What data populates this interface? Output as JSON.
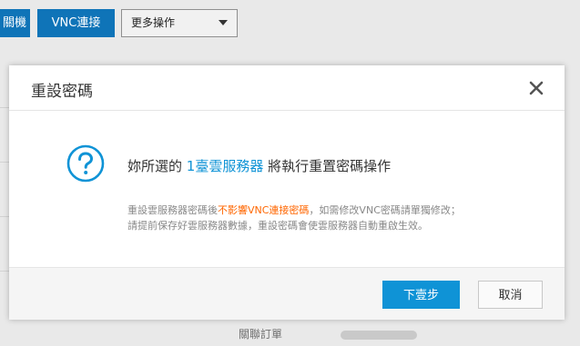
{
  "background": {
    "toolbar": {
      "partial_button_label": "關機",
      "vnc_button_label": "VNC連接",
      "more_actions_label": "更多操作"
    },
    "bottom_text": "關聯訂單"
  },
  "dialog": {
    "title": "重設密碼",
    "close_icon": "close-icon",
    "main_message": {
      "prefix": "妳所選的 ",
      "link_text": "1臺雲服務器",
      "suffix": " 將執行重置密碼操作"
    },
    "sub_message": {
      "line1_prefix": "重設雲服務器密碼後",
      "line1_warning": "不影響VNC連接密碼",
      "line1_suffix": "，如需修改VNC密碼請單獨修改；",
      "line2": "請提前保存好雲服務器數據，重設密碼會使雲服務器自動重啟生效。"
    },
    "buttons": {
      "next_label": "下壹步",
      "cancel_label": "取消"
    }
  },
  "colors": {
    "primary": "#0f93d6",
    "warning": "#ff6600",
    "toolbar_button": "#0f74b8"
  }
}
